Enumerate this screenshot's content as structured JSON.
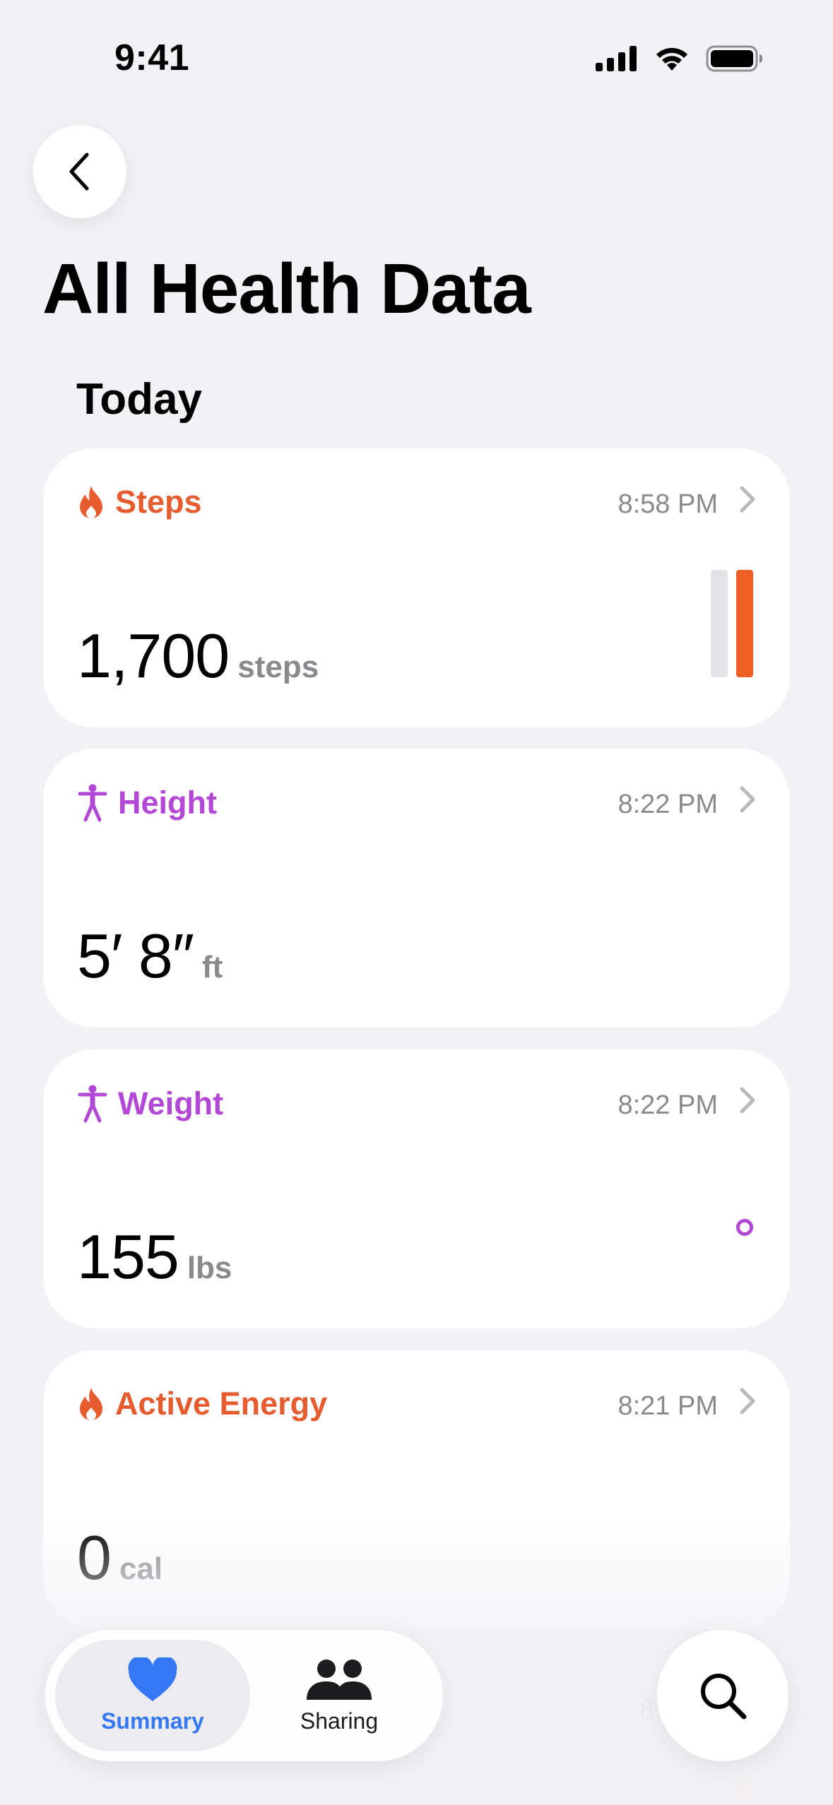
{
  "status_bar": {
    "time": "9:41"
  },
  "page": {
    "title": "All Health Data",
    "section": "Today"
  },
  "cards": [
    {
      "title": "Steps",
      "time": "8:58 PM",
      "value": "1,700",
      "unit": "steps",
      "color": "#e65c2f",
      "icon": "flame-icon"
    },
    {
      "title": "Height",
      "time": "8:22 PM",
      "value": "5′ 8″",
      "unit": "ft",
      "color": "#b347d6",
      "icon": "figure-icon"
    },
    {
      "title": "Weight",
      "time": "8:22 PM",
      "value": "155",
      "unit": "lbs",
      "color": "#b347d6",
      "icon": "figure-icon"
    },
    {
      "title": "Active Energy",
      "time": "8:21 PM",
      "value": "0",
      "unit": "cal",
      "color": "#e65c2f",
      "icon": "flame-icon"
    }
  ],
  "partial_card": {
    "time": "8:2"
  },
  "tab_bar": {
    "tabs": [
      {
        "label": "Summary",
        "icon": "heart-icon",
        "selected": true,
        "color": "#3478f6"
      },
      {
        "label": "Sharing",
        "icon": "people-icon",
        "selected": false
      }
    ]
  },
  "search": {
    "icon": "search-icon"
  }
}
